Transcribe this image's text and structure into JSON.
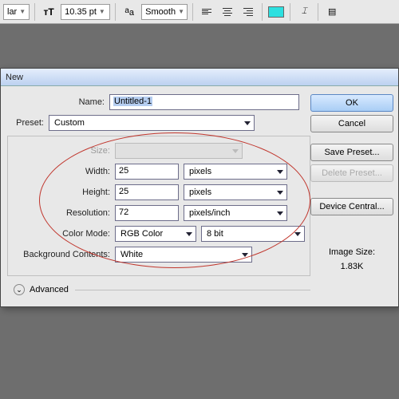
{
  "toolbar": {
    "fontStyleTail": "lar",
    "fontSize": "10.35 pt",
    "aa": "Smooth"
  },
  "dialog": {
    "title": "New",
    "name": {
      "label": "Name:",
      "value": "Untitled-1"
    },
    "preset": {
      "label": "Preset:",
      "value": "Custom"
    },
    "size": {
      "label": "Size:",
      "value": ""
    },
    "width": {
      "label": "Width:",
      "value": "25",
      "unit": "pixels"
    },
    "height": {
      "label": "Height:",
      "value": "25",
      "unit": "pixels"
    },
    "resolution": {
      "label": "Resolution:",
      "value": "72",
      "unit": "pixels/inch"
    },
    "colorMode": {
      "label": "Color Mode:",
      "value": "RGB Color",
      "depth": "8 bit"
    },
    "bgContents": {
      "label": "Background Contents:",
      "value": "White"
    },
    "advanced": "Advanced",
    "buttons": {
      "ok": "OK",
      "cancel": "Cancel",
      "savePreset": "Save Preset...",
      "deletePreset": "Delete Preset...",
      "deviceCentral": "Device Central..."
    },
    "imageSize": {
      "label": "Image Size:",
      "value": "1.83K"
    }
  }
}
